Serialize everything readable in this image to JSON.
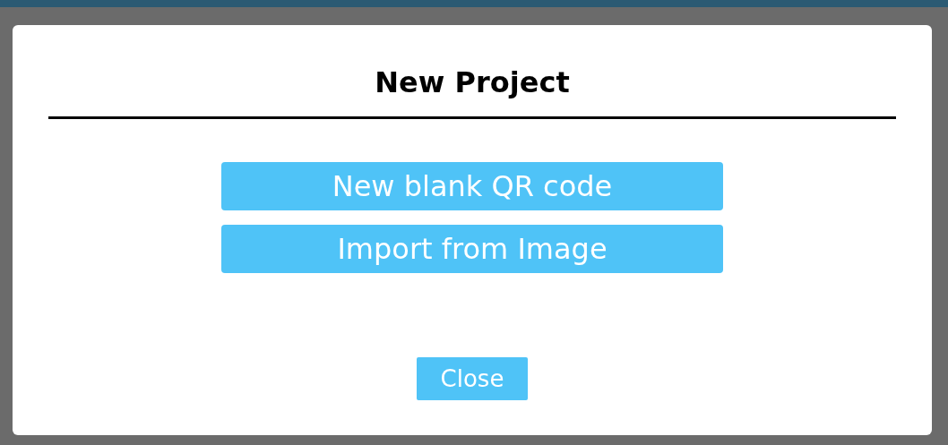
{
  "dialog": {
    "title": "New Project",
    "options": [
      "New blank QR code",
      "Import from Image"
    ],
    "close_button": "Close"
  }
}
